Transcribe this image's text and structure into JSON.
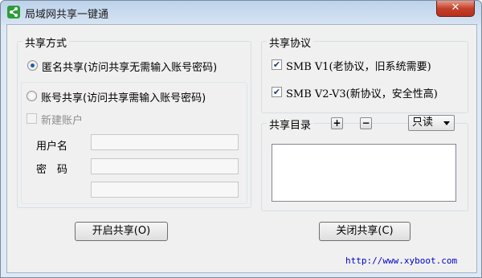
{
  "window": {
    "title": "局域网共享一键通",
    "close_label": "✕",
    "icon": "share-icon"
  },
  "share_mode": {
    "group_title": "共享方式",
    "anonymous_label": "匿名共享(访问共享无需输入账号密码)",
    "account_label": "账号共享(访问共享需输入账号密码)",
    "new_account_label": "新建账户",
    "username_label": "用户名",
    "password_label": "密　码",
    "username_value": "",
    "password_value": "",
    "confirm_value": ""
  },
  "protocol": {
    "group_title": "共享协议",
    "smb_v1_label": "SMB V1(老协议，旧系统需要)",
    "smb_v2_label": "SMB V2-V3(新协议，安全性高)"
  },
  "directory": {
    "title": "共享目录",
    "add_label": "+",
    "remove_label": "−",
    "access_mode": "只读"
  },
  "actions": {
    "start_label": "开启共享(O)",
    "stop_label": "关闭共享(C)"
  },
  "footer": {
    "url": "http://www.xyboot.com"
  }
}
